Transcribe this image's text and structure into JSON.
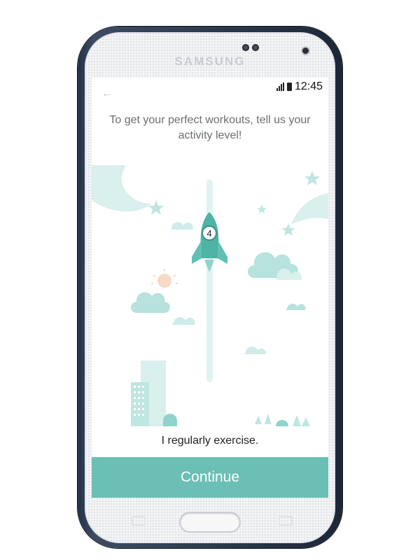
{
  "device": {
    "brand": "SAMSUNG"
  },
  "status_bar": {
    "time": "12:45"
  },
  "screen": {
    "back_icon": "arrow-left-icon",
    "headline": "To get your perfect workouts, tell us your activity level!",
    "slider": {
      "value": 4
    },
    "caption": "I regularly exercise.",
    "continue_label": "Continue"
  },
  "colors": {
    "accent": "#6bbfb5",
    "illustration_light": "#cfece8",
    "rocket": "#4fb3a6",
    "sun": "#f8d9c8"
  }
}
